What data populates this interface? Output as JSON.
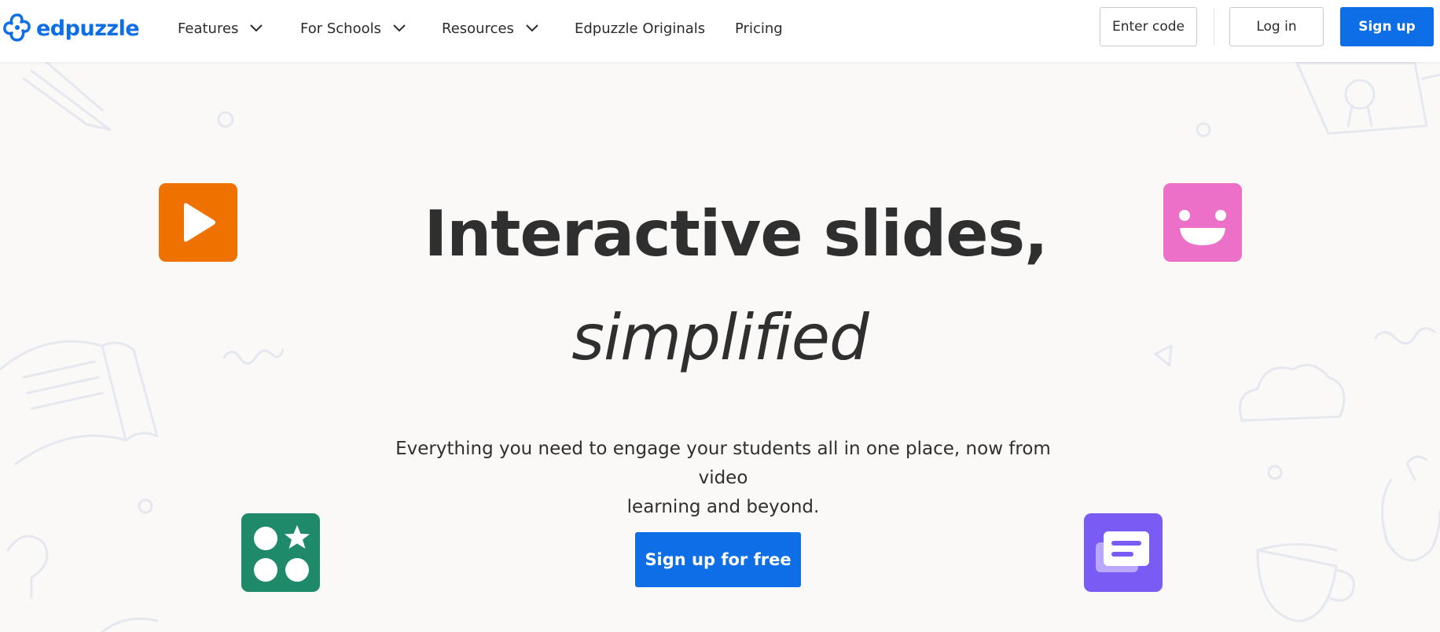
{
  "brand": {
    "logo_text": "edpuzzle",
    "accent": "#0d6ee6"
  },
  "nav": {
    "items": [
      {
        "label": "Features",
        "has_dropdown": true
      },
      {
        "label": "For Schools",
        "has_dropdown": true
      },
      {
        "label": "Resources",
        "has_dropdown": true
      },
      {
        "label": "Edpuzzle Originals",
        "has_dropdown": false
      },
      {
        "label": "Pricing",
        "has_dropdown": false
      }
    ],
    "enter_code": "Enter code",
    "log_in": "Log in",
    "sign_up": "Sign up"
  },
  "hero": {
    "title_line1": "Interactive slides,",
    "title_line2": "simplified",
    "subtitle_line1": "Everything you need to engage your students all in one place, now from video",
    "subtitle_line2": "learning and beyond.",
    "cta": "Sign up for free"
  },
  "tiles": [
    {
      "name": "play-icon",
      "color": "#ef7100"
    },
    {
      "name": "smiley-icon",
      "color": "#ec6fc8"
    },
    {
      "name": "quiz-shapes-icon",
      "color": "#1f8a6a"
    },
    {
      "name": "chat-cards-icon",
      "color": "#7a5cf5"
    }
  ]
}
